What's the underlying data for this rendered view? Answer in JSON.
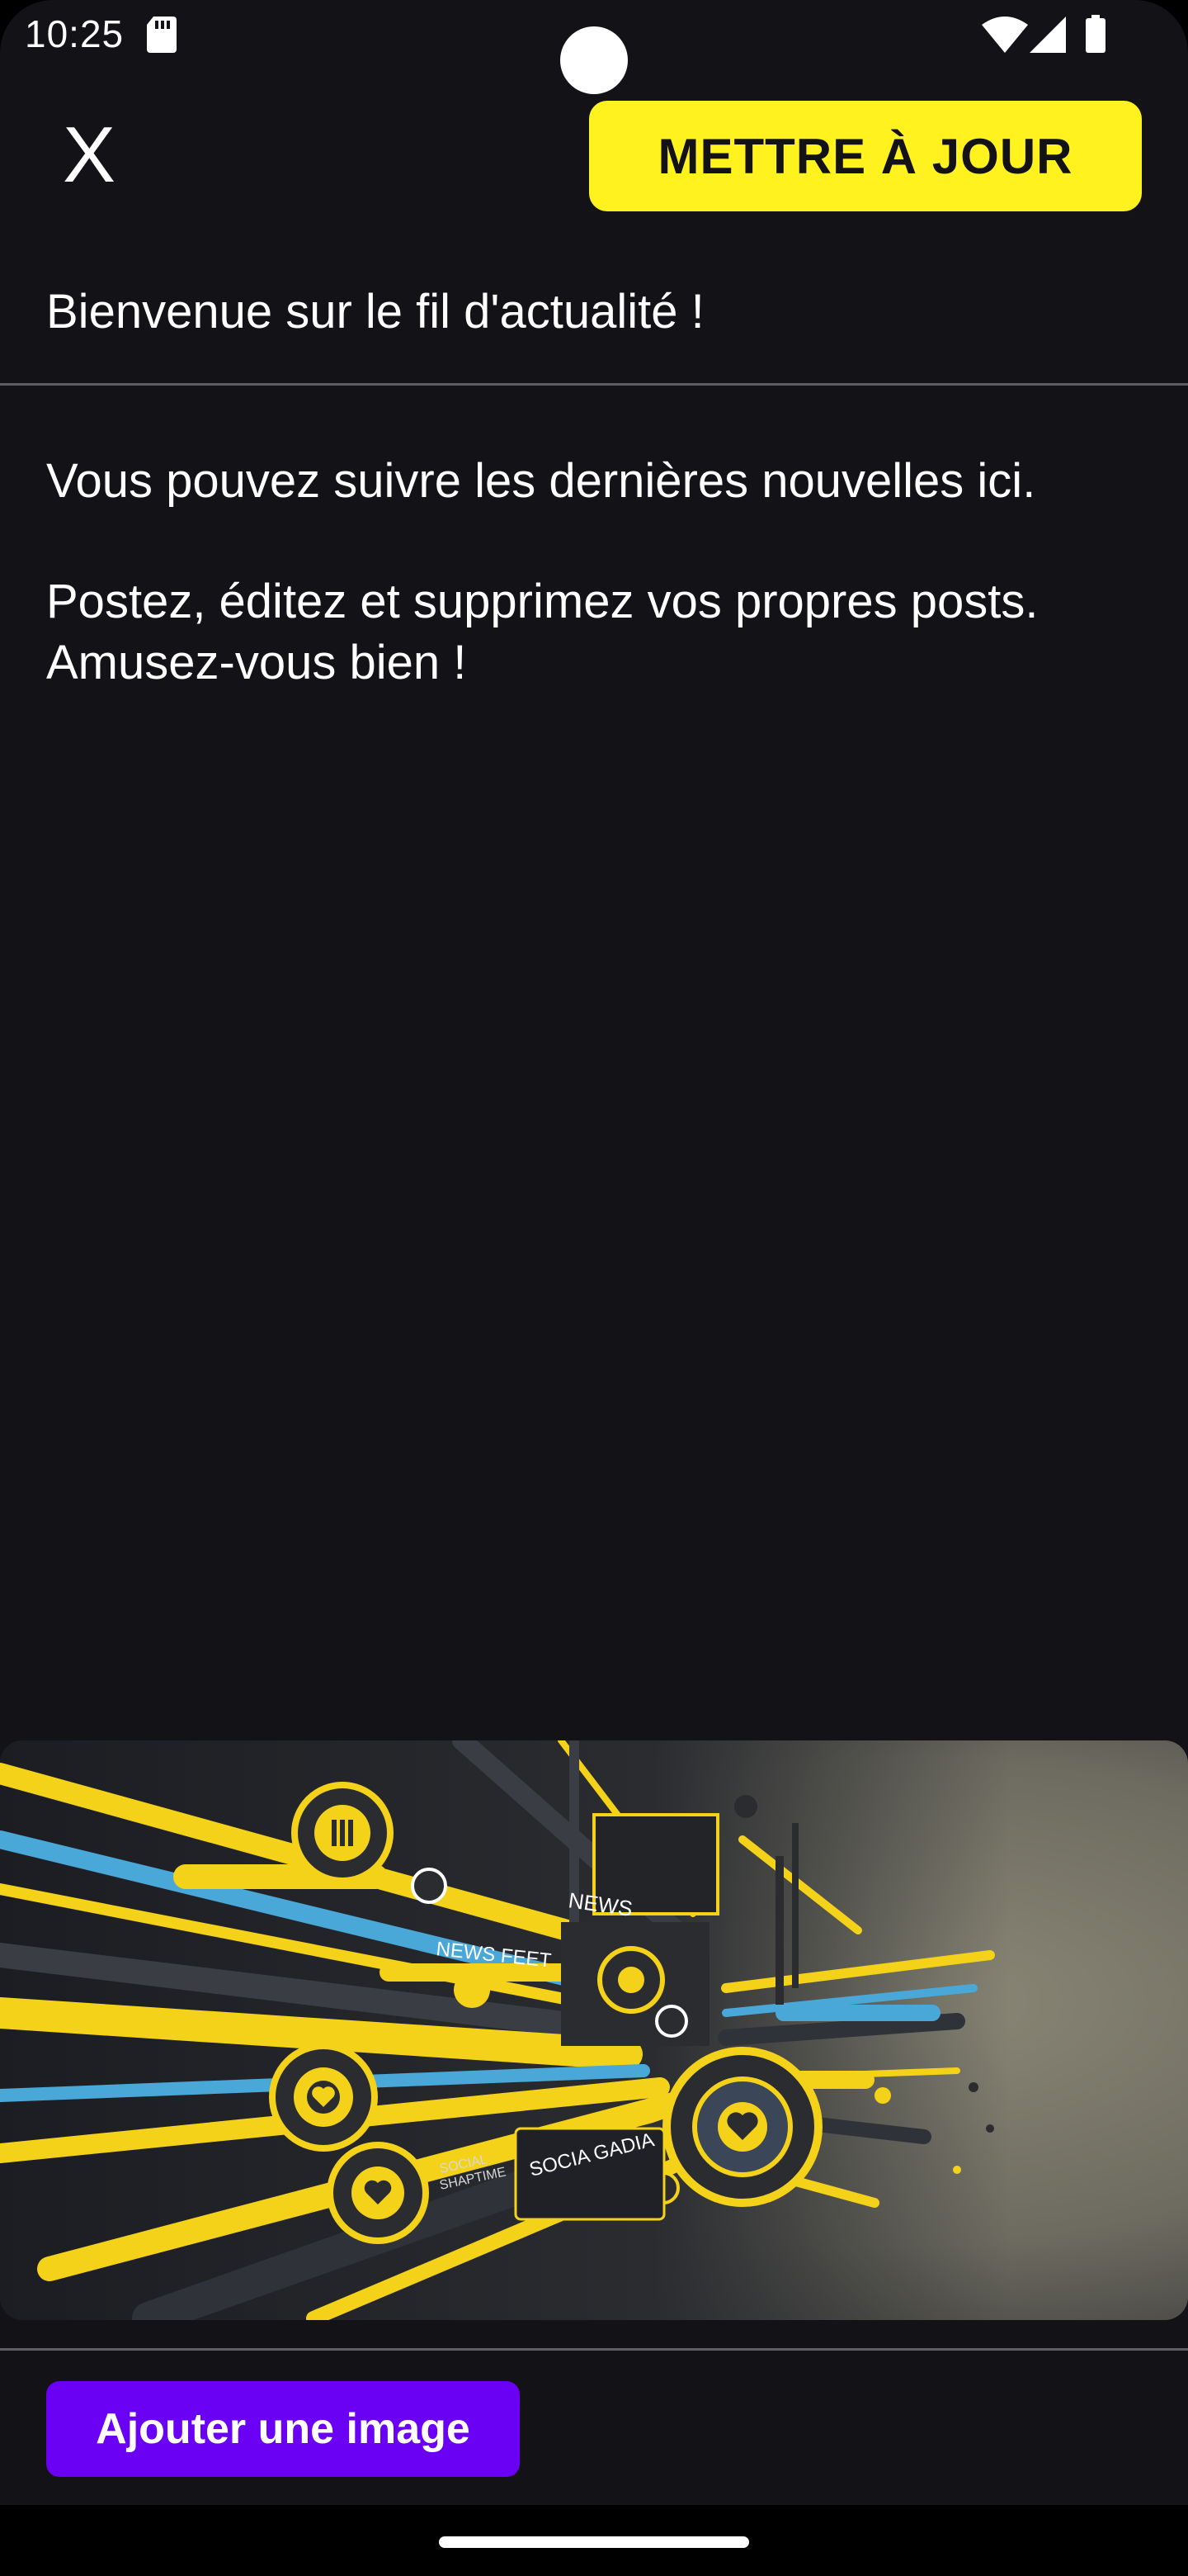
{
  "status_bar": {
    "time": "10:25",
    "icons": [
      "sd-card-icon",
      "wifi-icon",
      "cell-signal-icon",
      "battery-icon"
    ]
  },
  "toolbar": {
    "close_label": "X",
    "update_label": "METTRE À JOUR"
  },
  "header": {
    "title": "Bienvenue sur le fil d'actualité !"
  },
  "content": {
    "line1": "Vous pouvez suivre les dernières nouvelles ici.",
    "line2": "Postez, éditez et supprimez vos propres posts.",
    "line3": "Amusez-vous bien !"
  },
  "banner": {
    "text_news": "NEWS",
    "text_news_feet": "NEWS FEET",
    "text_socia_gadia": "SOCIA GADIA",
    "text_social": "SOCIAL",
    "text_shaptime": "SHAPTIME"
  },
  "footer": {
    "add_image_label": "Ajouter une image"
  },
  "colors": {
    "background": "#121217",
    "accent_yellow": "#fff21f",
    "accent_purple": "#6a00f4",
    "divider": "#5d5d63"
  }
}
